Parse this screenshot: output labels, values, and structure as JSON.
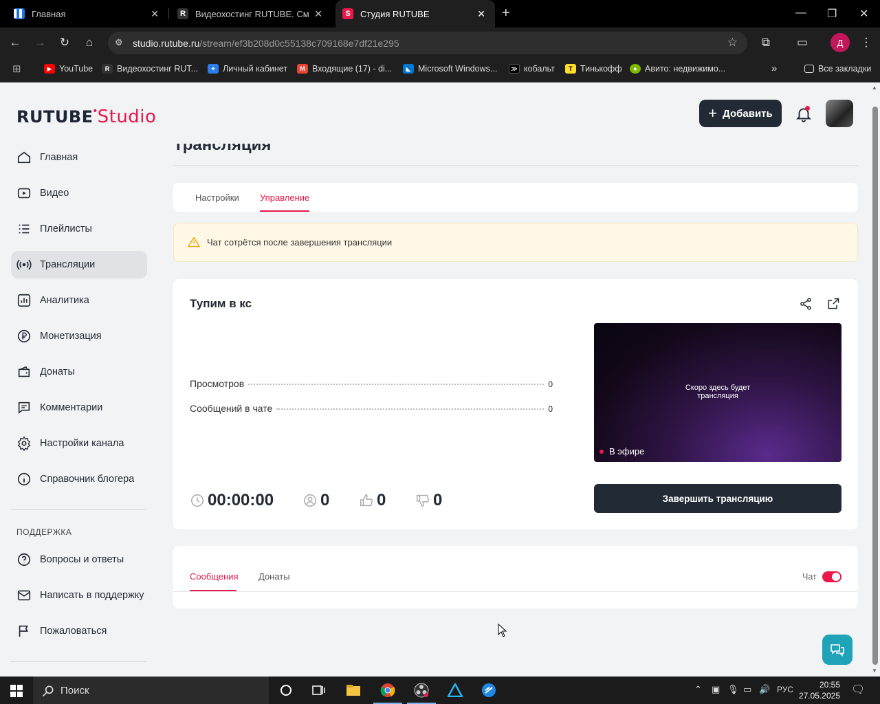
{
  "browser": {
    "tabs": [
      {
        "title": "Главная",
        "favicon": "vk-video-icon",
        "color": "#1a73e8"
      },
      {
        "title": "Видеохостинг RUTUBE. Смотр",
        "favicon": "rutube-icon",
        "color": "#222"
      },
      {
        "title": "Студия RUTUBE",
        "favicon": "rutube-studio-icon",
        "color": "#e9194a"
      }
    ],
    "url_host": "studio.rutube.ru",
    "url_path": "/stream/ef3b208d0c55138c709168e7df21e295",
    "profile_letter": "Д",
    "bookmarks": [
      {
        "label": "YouTube",
        "color": "#ff0000"
      },
      {
        "label": "Видеохостинг RUT...",
        "color": "#222"
      },
      {
        "label": "Личный кабинет",
        "color": "#2b7de9"
      },
      {
        "label": "Входящие (17) - di...",
        "color": "#ea4335"
      },
      {
        "label": "Microsoft Windows...",
        "color": "#0078d4"
      },
      {
        "label": "кобальт",
        "color": "#000"
      },
      {
        "label": "Тинькофф",
        "color": "#ffdd2d"
      },
      {
        "label": "Авито: недвижимо...",
        "color": "#7fba00"
      }
    ],
    "all_bookmarks": "Все закладки"
  },
  "header": {
    "logo_main": "RUTUBE",
    "logo_studio": "Studio",
    "add_label": "Добавить"
  },
  "sidebar": {
    "items": [
      {
        "label": "Главная",
        "icon": "home-icon"
      },
      {
        "label": "Видео",
        "icon": "video-icon"
      },
      {
        "label": "Плейлисты",
        "icon": "playlist-icon"
      },
      {
        "label": "Трансляции",
        "icon": "broadcast-icon"
      },
      {
        "label": "Аналитика",
        "icon": "analytics-icon"
      },
      {
        "label": "Монетизация",
        "icon": "ruble-icon"
      },
      {
        "label": "Донаты",
        "icon": "wallet-icon"
      },
      {
        "label": "Комментарии",
        "icon": "comment-icon"
      },
      {
        "label": "Настройки канала",
        "icon": "gear-icon"
      },
      {
        "label": "Справочник блогера",
        "icon": "info-icon"
      }
    ],
    "support_title": "ПОДДЕРЖКА",
    "support_items": [
      {
        "label": "Вопросы и ответы",
        "icon": "question-icon"
      },
      {
        "label": "Написать в поддержку",
        "icon": "mail-icon"
      },
      {
        "label": "Пожаловаться",
        "icon": "flag-icon"
      }
    ]
  },
  "main": {
    "page_title": "Трансляция",
    "tabs": [
      {
        "label": "Настройки"
      },
      {
        "label": "Управление"
      }
    ],
    "warning": "Чат сотрётся после завершения трансляции",
    "stream_title": "Тупим в кс",
    "stats": [
      {
        "label": "Просмотров",
        "value": "0"
      },
      {
        "label": "Сообщений в чате",
        "value": "0"
      }
    ],
    "preview_text_1": "Скоро здесь будет",
    "preview_text_2": "трансляция",
    "live_badge": "В эфире",
    "end_button": "Завершить трансляцию",
    "duration": "00:00:00",
    "viewers": "0",
    "likes": "0",
    "dislikes": "0",
    "chat_tabs": [
      {
        "label": "Сообщения"
      },
      {
        "label": "Донаты"
      }
    ],
    "chat_toggle_label": "Чат",
    "chat_enabled": true
  },
  "taskbar": {
    "search_placeholder": "Поиск",
    "lang": "РУС",
    "time": "20:55",
    "date": "27.05.2025"
  },
  "colors": {
    "accent": "#e9194a",
    "dark": "#222a35",
    "warning_bg": "#fff8e6",
    "help_fab": "#1fa3b8"
  }
}
